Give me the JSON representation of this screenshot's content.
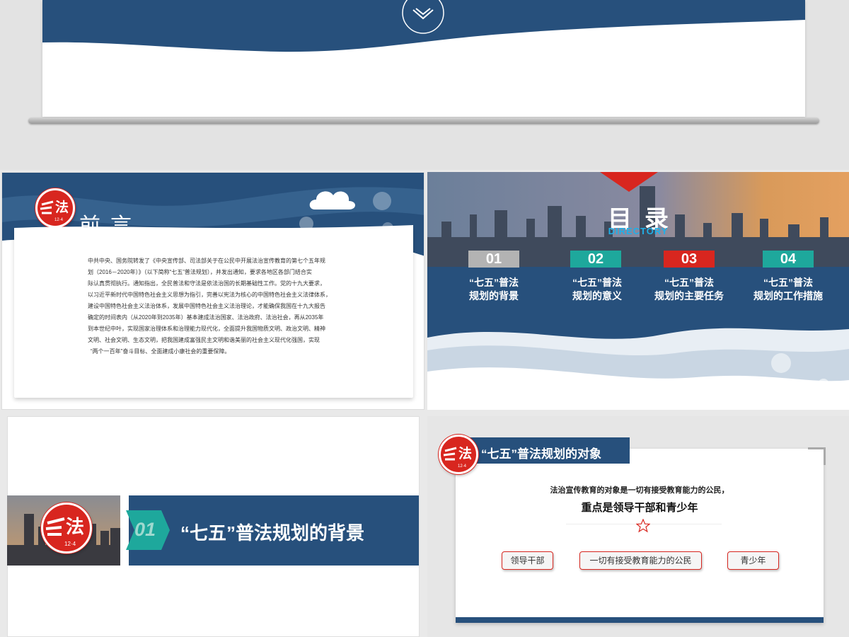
{
  "top_slide": {
    "icon": "chevron-down-icon"
  },
  "logo": {
    "glyph": "法",
    "badge": "12·4"
  },
  "preface": {
    "title": "前言",
    "paragraph": [
      "中共中央、国务院转发了《中央宣传部、司法部关于在公民中开展法治宣传教育的第七个五年规",
      "划（2016－2020年）》（以下简称“七五”普法规划），并发出通知，要求各地区各部门结合实",
      "际认真贯彻执行。通知指出，全民普法和守法是依法治国的长期基础性工作。党的十九大要求，",
      "以习近平新时代中国特色社会主义思想为指引，完善以宪法为核心的中国特色社会主义法律体系，",
      "建设中国特色社会主义法治体系，发展中国特色社会主义法治理论，才能确保我国在十九大报告",
      "确定的时间表内（从2020年到2035年）基本建成法治国家、法治政府、法治社会，再从2035年",
      "到本世纪中叶，实现国家治理体系和治理能力现代化，全面提升我国物质文明、政治文明、精神",
      "文明、社会文明、生态文明，把我国建成富强民主文明和谐美丽的社会主义现代化强国，实现",
      "“两个一百年”奋斗目标、全面建成小康社会的重要保障。"
    ]
  },
  "directory": {
    "title": "目录",
    "subtitle": "DIRECTORY",
    "items": [
      {
        "num": "01",
        "line1": "“七五”普法",
        "line2": "规划的背景",
        "color": "#b3b3b3"
      },
      {
        "num": "02",
        "line1": "“七五”普法",
        "line2": "规划的意义",
        "color": "#1ea89c"
      },
      {
        "num": "03",
        "line1": "“七五”普法",
        "line2": "规划的主要任务",
        "color": "#d8261f"
      },
      {
        "num": "04",
        "line1": "“七五”普法",
        "line2": "规划的工作措施",
        "color": "#1ea89c"
      }
    ]
  },
  "section": {
    "num": "01",
    "title": "“七五”普法规划的背景"
  },
  "object": {
    "header": "“七五”普法规划的对象",
    "line1": "法治宣传教育的对象是一切有接受教育能力的公民，",
    "line2": "重点是领导干部和青少年",
    "star_icon": "star-icon",
    "pills": [
      "领导干部",
      "一切有接受教育能力的公民",
      "青少年"
    ]
  }
}
